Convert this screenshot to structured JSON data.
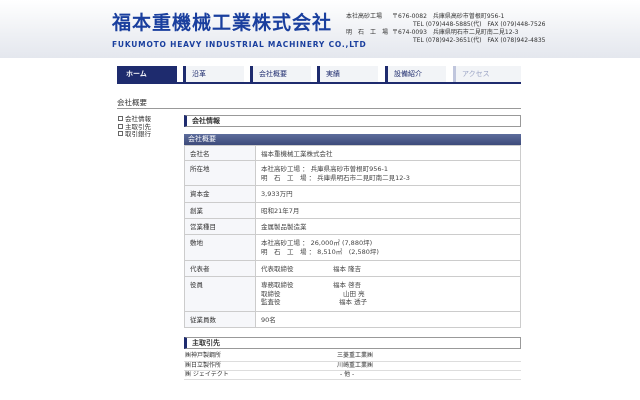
{
  "header": {
    "company_jp": "福本重機械工業株式会社",
    "company_en": "FUKUMOTO HEAVY INDUSTRIAL MACHINERY CO.,LTD",
    "takasago": {
      "label": "本社高砂工場",
      "address": "〒676-0082　兵庫県高砂市曽根町956-1",
      "tel": "TEL (079)448-5885(代)　FAX (079)448-7526"
    },
    "akashi": {
      "label": "明　石　工　場",
      "address": "〒674-0093　兵庫県明石市二見町南二見12-3",
      "tel": "TEL (078)942-3651(代)　FAX (078)942-4835"
    }
  },
  "nav": {
    "tabs": [
      {
        "label": "ホーム",
        "state": "active"
      },
      {
        "label": "沿革",
        "state": "normal"
      },
      {
        "label": "会社概要",
        "state": "normal"
      },
      {
        "label": "実績",
        "state": "normal"
      },
      {
        "label": "設備紹介",
        "state": "normal"
      },
      {
        "label": "アクセス",
        "state": "dim"
      }
    ]
  },
  "page_title": "会社概要",
  "sidebar": {
    "items": [
      {
        "label": "会社情報"
      },
      {
        "label": "主取引先"
      },
      {
        "label": "取引銀行"
      }
    ]
  },
  "company_info": {
    "section_title": "会社情報",
    "table_heading": "会社概要",
    "rows": {
      "name": {
        "label": "会社名",
        "value": "福本重機械工業株式会社"
      },
      "address": {
        "label": "所在地",
        "line1": "本社高砂工場 ： 兵庫県高砂市曽根町956-1",
        "line2": "明　石　工　場 ： 兵庫県明石市二見町南二見12-3"
      },
      "capital": {
        "label": "資本金",
        "value": "3,933万円"
      },
      "founded": {
        "label": "創業",
        "value": "昭和21年7月"
      },
      "business": {
        "label": "営業種目",
        "value": "金属製品製造業"
      },
      "site": {
        "label": "敷地",
        "line1": "本社高砂工場 ： 26,000㎡ (7,880坪)",
        "line2": "明　石　工　場 ：  8,510㎡　(2,580坪)"
      },
      "representative": {
        "label": "代表者",
        "title": "代表取締役",
        "name": "福本 隆吉"
      },
      "officers": {
        "label": "役員",
        "list": [
          {
            "title": "専務取締役",
            "name": "福本 啓吾"
          },
          {
            "title": "取締役",
            "name": "山田 亮"
          },
          {
            "title": "監査役",
            "name": "福本 透子"
          }
        ]
      },
      "employees": {
        "label": "従業員数",
        "value": "90名"
      }
    }
  },
  "customers": {
    "section_title": "主取引先",
    "rows": [
      {
        "left": "㈱神戸製鋼所",
        "right": "三菱重工業㈱"
      },
      {
        "left": "㈱日立製作所",
        "right": "川崎重工業㈱"
      },
      {
        "left": "㈱ ジェイテクト",
        "right": "- 他 -"
      }
    ]
  }
}
